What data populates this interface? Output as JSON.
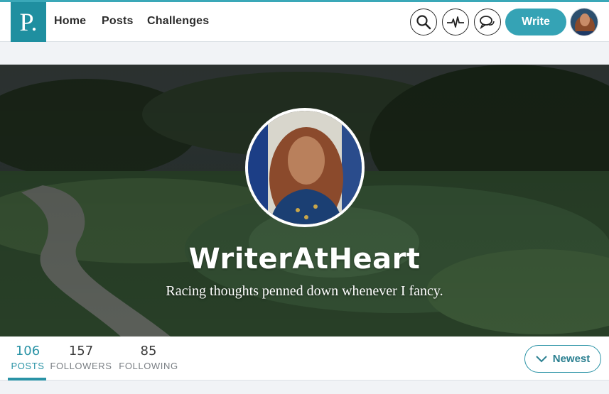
{
  "nav": {
    "logo": "P.",
    "links": [
      "Home",
      "Posts",
      "Challenges"
    ],
    "icons": [
      "search-icon",
      "activity-icon",
      "chat-icon"
    ],
    "write_label": "Write"
  },
  "profile": {
    "username": "WriterAtHeart",
    "tagline": "Racing thoughts penned down whenever I fancy."
  },
  "stats": [
    {
      "value": "106",
      "label": "POSTS"
    },
    {
      "value": "157",
      "label": "FOLLOWERS"
    },
    {
      "value": "85",
      "label": "FOLLOWING"
    }
  ],
  "sort": {
    "label": "Newest",
    "icon": "chevron-down-icon"
  },
  "colors": {
    "accent": "#35a3b5",
    "logo": "#1f8fa0"
  }
}
